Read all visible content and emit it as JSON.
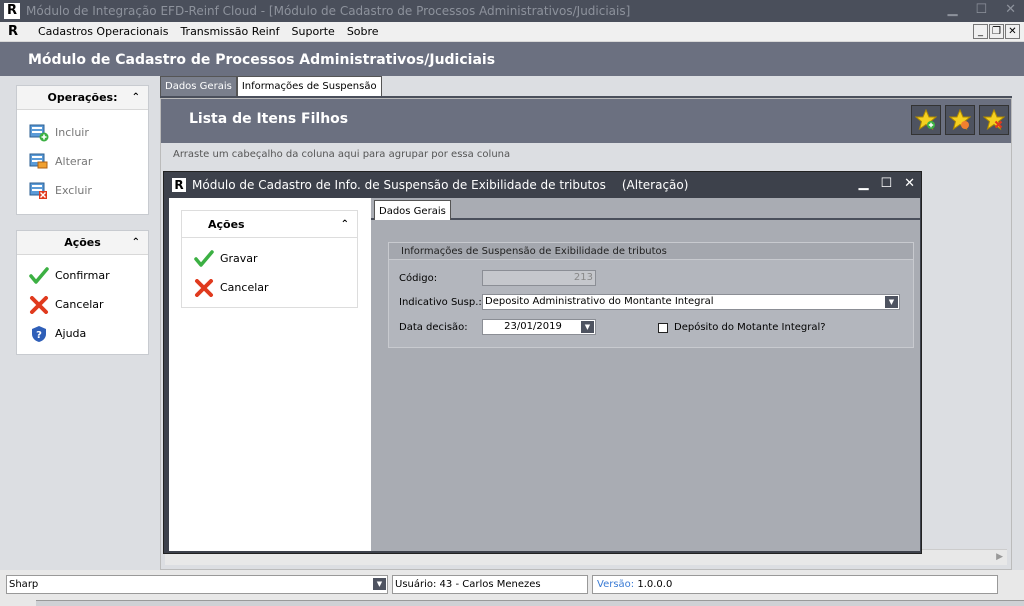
{
  "window": {
    "title": "Módulo de Integração EFD-Reinf Cloud - [Módulo de Cadastro de Processos Administrativos/Judiciais]",
    "logo": "R"
  },
  "menu": {
    "items": [
      "Cadastros Operacionais",
      "Transmissão Reinf",
      "Suporte",
      "Sobre"
    ]
  },
  "module": {
    "title": "Módulo de Cadastro de Processos Administrativos/Judiciais"
  },
  "operacoes": {
    "title": "Operações:",
    "items": [
      "Incluir",
      "Alterar",
      "Excluir"
    ]
  },
  "acoes": {
    "title": "Ações",
    "items": [
      "Confirmar",
      "Cancelar",
      "Ajuda"
    ]
  },
  "tabs": [
    "Dados Gerais",
    "Informações de Suspensão"
  ],
  "list": {
    "title": "Lista de Itens Filhos",
    "group_hint": "Arraste um cabeçalho da coluna aqui para agrupar por essa coluna"
  },
  "dialog": {
    "title": "Módulo de Cadastro de Info. de Suspensão de Exibilidade de tributos",
    "mode": "(Alteração)",
    "acoes_title": "Ações",
    "acoes_items": [
      "Gravar",
      "Cancelar"
    ],
    "tab": "Dados Gerais",
    "group_title": "Informações de Suspensão de Exibilidade de tributos",
    "codigo_label": "Código:",
    "codigo_value": "213",
    "indicativo_label": "Indicativo Susp.:",
    "indicativo_value": "Deposito Administrativo do Montante Integral",
    "data_label": "Data decisão:",
    "data_value": "23/01/2019",
    "deposito_label": "Depósito do Motante Integral?"
  },
  "status": {
    "combo": "Sharp",
    "user": "Usuário: 43 - Carlos Menezes",
    "version_label": "Versão:",
    "version_value": "1.0.0.0"
  },
  "colors": {
    "header_bg": "#6b7080",
    "dark_bg": "#4a4f5b",
    "dialog_bg": "#3d414b",
    "green_check": "#3cb043",
    "red_x": "#e03a1e",
    "link_blue": "#3a7bd5"
  }
}
